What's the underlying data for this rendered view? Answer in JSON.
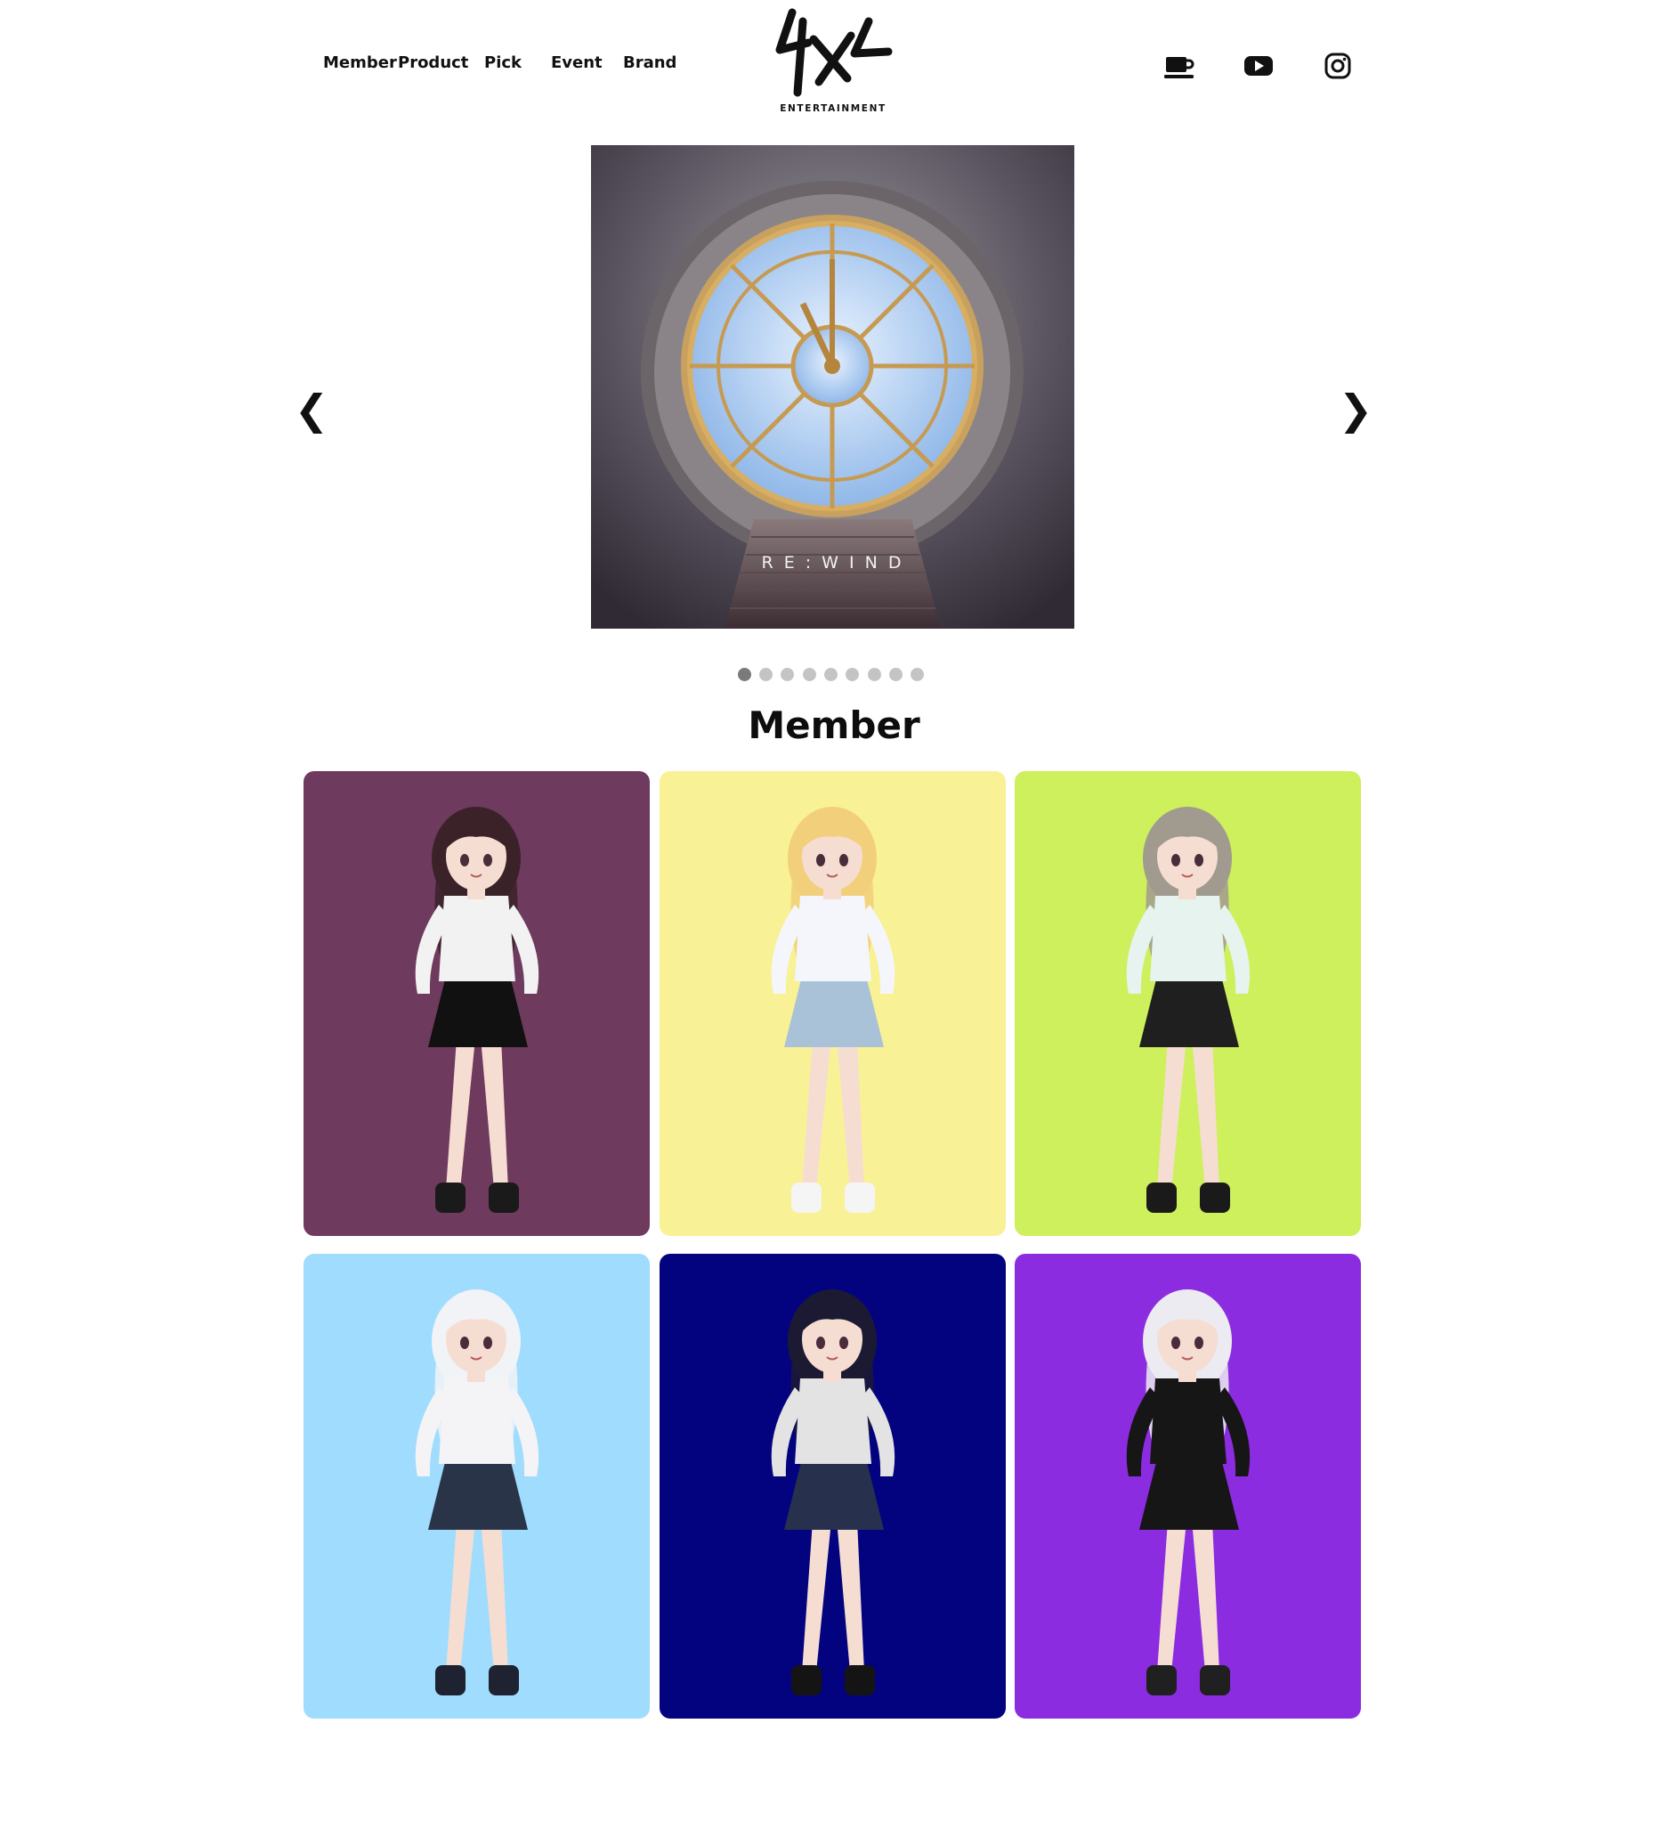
{
  "header": {
    "nav": [
      "Member",
      "Product",
      "Pick",
      "Event",
      "Brand"
    ],
    "logo_text": "ENTERTAINMENT",
    "social": [
      "coffee-icon",
      "youtube-icon",
      "instagram-icon"
    ]
  },
  "carousel": {
    "prev_label": "❮",
    "next_label": "❯",
    "slide_caption": "R E : W I N D",
    "total_slides": 9,
    "active_slide": 1
  },
  "member": {
    "title": "Member",
    "cards": [
      {
        "bg": "#6e3a5e",
        "hair": "#3a2228",
        "top": "#f2f2f2",
        "bottom": "#111111",
        "shoe": "#1a1a1a"
      },
      {
        "bg": "#f9f195",
        "hair": "#f2cf7a",
        "top": "#f4f6fb",
        "bottom": "#a9c2d8",
        "shoe": "#f5f5f5"
      },
      {
        "bg": "#cdf05c",
        "hair": "#a19a8e",
        "top": "#e6f3ee",
        "bottom": "#1f1f1f",
        "shoe": "#1a1a1a"
      },
      {
        "bg": "#9fdcfd",
        "hair": "#f1f3f7",
        "top": "#f4f4f6",
        "bottom": "#2a3448",
        "shoe": "#1f2230"
      },
      {
        "bg": "#030380",
        "hair": "#1c1a33",
        "top": "#e3e3e3",
        "bottom": "#27304d",
        "shoe": "#141414"
      },
      {
        "bg": "#8c2ce0",
        "hair": "#ecebf1",
        "top": "#161616",
        "bottom": "#161616",
        "shoe": "#202020"
      }
    ]
  }
}
